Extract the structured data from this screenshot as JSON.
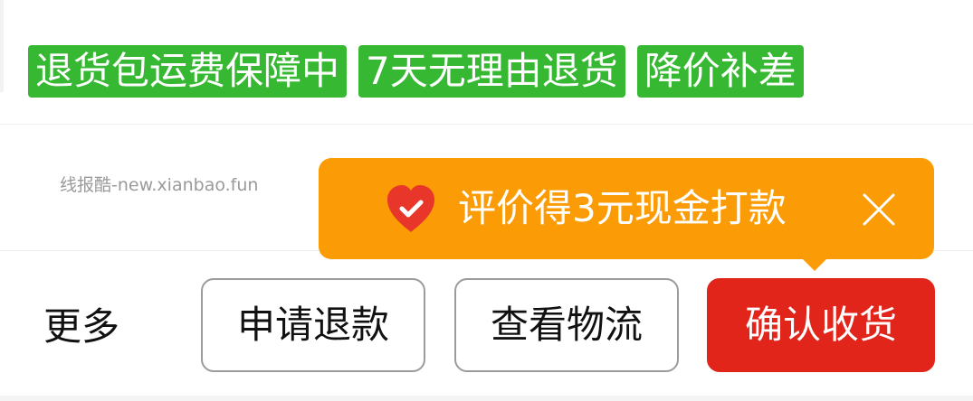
{
  "tags": [
    "退货包运费保障中",
    "7天无理由退货",
    "降价补差"
  ],
  "watermark": "线报酷-new.xianbao.fun",
  "tooltip": {
    "icon": "heart-check-icon",
    "text": "评价得3元现金打款",
    "close_icon": "close-icon"
  },
  "actions": {
    "more_label": "更多",
    "refund_label": "申请退款",
    "logistics_label": "查看物流",
    "confirm_label": "确认收货"
  },
  "colors": {
    "tag_green": "#36b832",
    "tooltip_orange": "#fb9b05",
    "confirm_red": "#e1251b"
  }
}
